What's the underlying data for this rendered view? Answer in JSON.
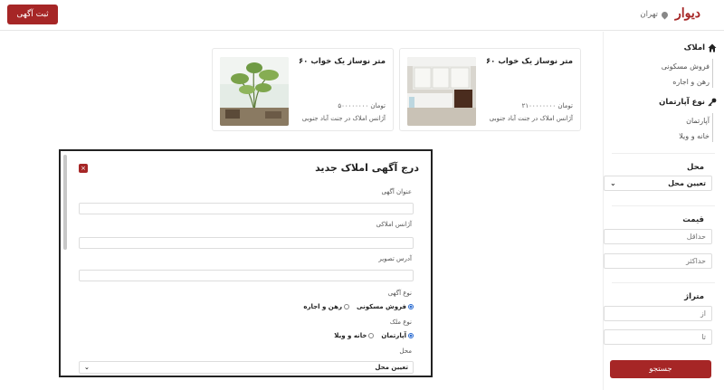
{
  "header": {
    "post_button": "ثبت آگهی",
    "logo": "دیوار",
    "city": "تهران"
  },
  "sidebar": {
    "category_title": "املاک",
    "category_items": [
      "فروش مسکونی",
      "رهن و اجاره"
    ],
    "apartment_type_title": "نوع آپارتمان",
    "apartment_type_items": [
      "آپارتمان",
      "خانه و ویلا"
    ],
    "location_label": "محل",
    "location_select": "تعیین محل",
    "price_label": "قیمت",
    "price_min_placeholder": "حداقل",
    "price_max_placeholder": "حداکثر",
    "area_label": "متراژ",
    "area_from_placeholder": "از",
    "area_to_placeholder": "تا",
    "search_button": "جستجو"
  },
  "listings": [
    {
      "title": "۶۰ متر نوساز یک خواب",
      "price": "۲۱۰۰۰۰۰۰۰۰ تومان",
      "agency": "آژانس املاک در جنت آباد جنوبی"
    },
    {
      "title": "۶۰ متر نوساز یک خواب",
      "price": "۵۰۰۰۰۰۰۰۰ تومان",
      "agency": "آژانس املاک در جنت آباد جنوبی"
    }
  ],
  "modal": {
    "title": "درج آگهی املاک جدید",
    "close": "×",
    "field_title_label": "عنوان آگهی",
    "field_agency_label": "آژانس املاکی",
    "field_image_label": "آدرس تصویر",
    "ad_type_label": "نوع آگهی",
    "ad_type_options": [
      "فروش مسکونی",
      "رهن و اجاره"
    ],
    "property_type_label": "نوع ملک",
    "property_type_options": [
      "آپارتمان",
      "خانه و ویلا"
    ],
    "location_label": "محل",
    "location_select": "تعیین محل"
  },
  "colors": {
    "accent": "#a62626",
    "radio": "#2a6bd1"
  }
}
